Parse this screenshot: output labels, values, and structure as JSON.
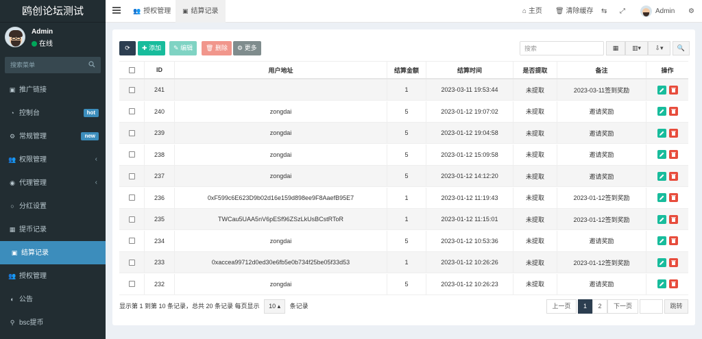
{
  "app": {
    "title": "鸥创论坛测试"
  },
  "user": {
    "name": "Admin",
    "status": "在线"
  },
  "sidebar": {
    "search_placeholder": "搜索菜单",
    "items": [
      {
        "label": "推广链接",
        "icon": "link-icon"
      },
      {
        "label": "控制台",
        "icon": "dashboard-icon",
        "badge": "hot"
      },
      {
        "label": "常规管理",
        "icon": "cogs-icon",
        "badge": "new"
      },
      {
        "label": "权限管理",
        "icon": "group-icon",
        "arrow": "‹"
      },
      {
        "label": "代理管理",
        "icon": "user-circle-icon",
        "arrow": "‹"
      },
      {
        "label": "分红设置",
        "icon": "circle-icon"
      },
      {
        "label": "提币记录",
        "icon": "sitemap-icon"
      },
      {
        "label": "结算记录",
        "icon": "record-icon",
        "active": true
      },
      {
        "label": "授权管理",
        "icon": "group-icon"
      },
      {
        "label": "公告",
        "icon": "half-circle-icon"
      },
      {
        "label": "bsc提币",
        "icon": "bicycle-icon"
      }
    ]
  },
  "topbar": {
    "tabs": [
      {
        "label": "授权管理",
        "icon": "group-icon"
      },
      {
        "label": "结算记录",
        "icon": "record-icon",
        "active": true
      }
    ],
    "home": "主页",
    "clear_cache": "清除缓存",
    "admin": "Admin"
  },
  "toolbar": {
    "refresh": "",
    "add": "添加",
    "edit": "编辑",
    "delete": "删除",
    "more": "更多",
    "search_placeholder": "搜索"
  },
  "table": {
    "headers": [
      "",
      "ID",
      "用户地址",
      "结算金额",
      "结算时间",
      "是否提取",
      "备注",
      "操作"
    ],
    "rows": [
      {
        "id": "241",
        "address": "",
        "amount": "1",
        "time": "2023-03-11 19:53:44",
        "withdrawn": "未提取",
        "note": "2023-03-11签到奖励"
      },
      {
        "id": "240",
        "address": "zongdai",
        "amount": "5",
        "time": "2023-01-12 19:07:02",
        "withdrawn": "未提取",
        "note": "邀请奖励"
      },
      {
        "id": "239",
        "address": "zongdai",
        "amount": "5",
        "time": "2023-01-12 19:04:58",
        "withdrawn": "未提取",
        "note": "邀请奖励"
      },
      {
        "id": "238",
        "address": "zongdai",
        "amount": "5",
        "time": "2023-01-12 15:09:58",
        "withdrawn": "未提取",
        "note": "邀请奖励"
      },
      {
        "id": "237",
        "address": "zongdai",
        "amount": "5",
        "time": "2023-01-12 14:12:20",
        "withdrawn": "未提取",
        "note": "邀请奖励"
      },
      {
        "id": "236",
        "address": "0xF599c6E623D9b02d16e159d898ee9F8AaefB95E7",
        "amount": "1",
        "time": "2023-01-12 11:19:43",
        "withdrawn": "未提取",
        "note": "2023-01-12签到奖励"
      },
      {
        "id": "235",
        "address": "TWCau5UAA5nV6pESf96ZSzLkUsBCstRToR",
        "amount": "1",
        "time": "2023-01-12 11:15:01",
        "withdrawn": "未提取",
        "note": "2023-01-12签到奖励"
      },
      {
        "id": "234",
        "address": "zongdai",
        "amount": "5",
        "time": "2023-01-12 10:53:36",
        "withdrawn": "未提取",
        "note": "邀请奖励"
      },
      {
        "id": "233",
        "address": "0xaccea99712d0ed30e6fb5e0b734f25be05f33d53",
        "amount": "1",
        "time": "2023-01-12 10:26:26",
        "withdrawn": "未提取",
        "note": "2023-01-12签到奖励"
      },
      {
        "id": "232",
        "address": "zongdai",
        "amount": "5",
        "time": "2023-01-12 10:26:23",
        "withdrawn": "未提取",
        "note": "邀请奖励"
      }
    ]
  },
  "footer": {
    "info_prefix": "显示第 1 到第 10 条记录，总共 20 条记录 每页显示",
    "page_size": "10",
    "info_suffix": "条记录"
  },
  "pagination": {
    "prev": "上一页",
    "pages": [
      "1",
      "2"
    ],
    "next": "下一页",
    "goto": "跳转"
  },
  "colors": {
    "sidebar_bg": "#222d32",
    "active_blue": "#3c8dbc",
    "primary_dark": "#2c3e50",
    "success": "#18bc9c",
    "danger": "#e74c3c",
    "info": "#7f8c8d"
  }
}
